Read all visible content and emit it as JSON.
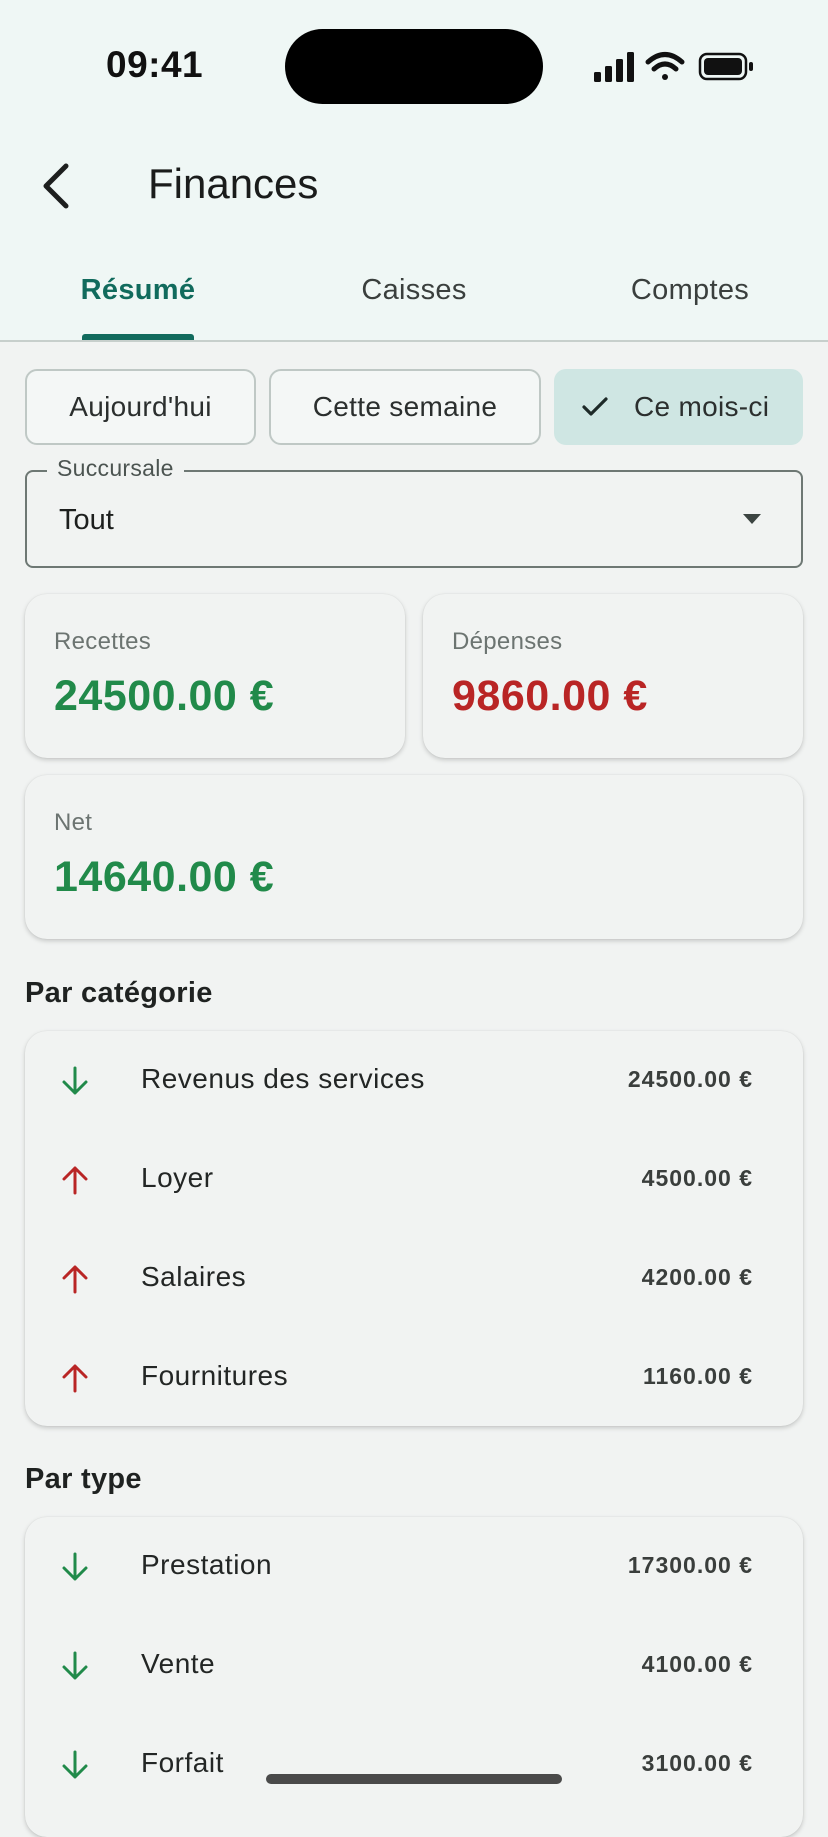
{
  "status_bar": {
    "time": "09:41"
  },
  "app_bar": {
    "title": "Finances"
  },
  "tabs": [
    {
      "label": "Résumé",
      "active": true
    },
    {
      "label": "Caisses",
      "active": false
    },
    {
      "label": "Comptes",
      "active": false
    }
  ],
  "period_filters": [
    {
      "label": "Aujourd'hui",
      "selected": false
    },
    {
      "label": "Cette semaine",
      "selected": false
    },
    {
      "label": "Ce mois-ci",
      "selected": true
    }
  ],
  "branch_select": {
    "label": "Succursale",
    "value": "Tout"
  },
  "summary": {
    "income": {
      "label": "Recettes",
      "value": "24500.00 €"
    },
    "expenses": {
      "label": "Dépenses",
      "value": "9860.00 €"
    },
    "net": {
      "label": "Net",
      "value": "14640.00 €"
    }
  },
  "by_category": {
    "title": "Par catégorie",
    "rows": [
      {
        "label": "Revenus des services",
        "amount": "24500.00 €",
        "direction": "down",
        "icon": "arrow-down-icon"
      },
      {
        "label": "Loyer",
        "amount": "4500.00 €",
        "direction": "up",
        "icon": "arrow-up-icon"
      },
      {
        "label": "Salaires",
        "amount": "4200.00 €",
        "direction": "up",
        "icon": "arrow-up-icon"
      },
      {
        "label": "Fournitures",
        "amount": "1160.00 €",
        "direction": "up",
        "icon": "arrow-up-icon"
      }
    ]
  },
  "by_type": {
    "title": "Par type",
    "rows": [
      {
        "label": "Prestation",
        "amount": "17300.00 €",
        "direction": "down",
        "icon": "arrow-down-icon"
      },
      {
        "label": "Vente",
        "amount": "4100.00 €",
        "direction": "down",
        "icon": "arrow-down-icon"
      },
      {
        "label": "Forfait",
        "amount": "3100.00 €",
        "direction": "down",
        "icon": "arrow-down-icon"
      }
    ]
  },
  "colors": {
    "accent": "#116b5d",
    "income": "#218a4a",
    "expense": "#b92525",
    "chip_selected": "#cfe6e3"
  }
}
